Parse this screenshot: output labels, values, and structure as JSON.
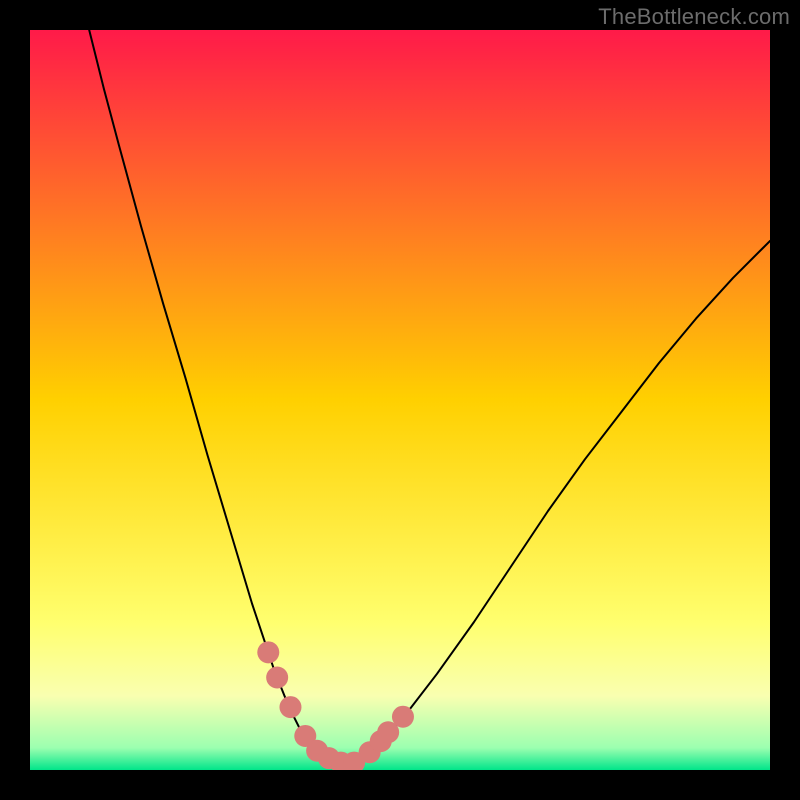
{
  "watermark": "TheBottleneck.com",
  "chart_data": {
    "type": "line",
    "title": "",
    "xlabel": "",
    "ylabel": "",
    "xlim": [
      0,
      100
    ],
    "ylim": [
      0,
      100
    ],
    "grid": false,
    "legend": false,
    "background_gradient": {
      "stops": [
        {
          "offset": 0.0,
          "color": "#ff1a49"
        },
        {
          "offset": 0.5,
          "color": "#ffd000"
        },
        {
          "offset": 0.8,
          "color": "#ffff6e"
        },
        {
          "offset": 0.9,
          "color": "#f9ffb0"
        },
        {
          "offset": 0.97,
          "color": "#9cffb0"
        },
        {
          "offset": 1.0,
          "color": "#00e58a"
        }
      ]
    },
    "series": [
      {
        "name": "bottleneck-curve",
        "type": "line",
        "color": "#000000",
        "stroke_width": 2,
        "x": [
          8,
          10,
          12,
          15,
          18,
          21,
          24,
          27,
          30,
          33,
          35,
          37,
          39,
          40.5,
          42,
          44,
          47,
          50,
          55,
          60,
          65,
          70,
          75,
          80,
          85,
          90,
          95,
          100
        ],
        "y": [
          100,
          92,
          84.5,
          73.5,
          63,
          53,
          42.5,
          32.5,
          22.5,
          13.5,
          8.5,
          4.5,
          2,
          1.2,
          1,
          1.4,
          3.4,
          6.5,
          13,
          20,
          27.5,
          35,
          42,
          48.5,
          55,
          61,
          66.5,
          71.5
        ]
      },
      {
        "name": "highlight-dots",
        "type": "scatter",
        "color": "#d97b77",
        "marker_radius": 11,
        "x": [
          32.2,
          33.4,
          35.2,
          37.2,
          38.8,
          40.4,
          42.0,
          43.8,
          45.9,
          47.4,
          48.4,
          50.4
        ],
        "y": [
          15.9,
          12.5,
          8.5,
          4.6,
          2.6,
          1.6,
          1.0,
          1.0,
          2.4,
          3.9,
          5.1,
          7.2
        ]
      }
    ]
  }
}
